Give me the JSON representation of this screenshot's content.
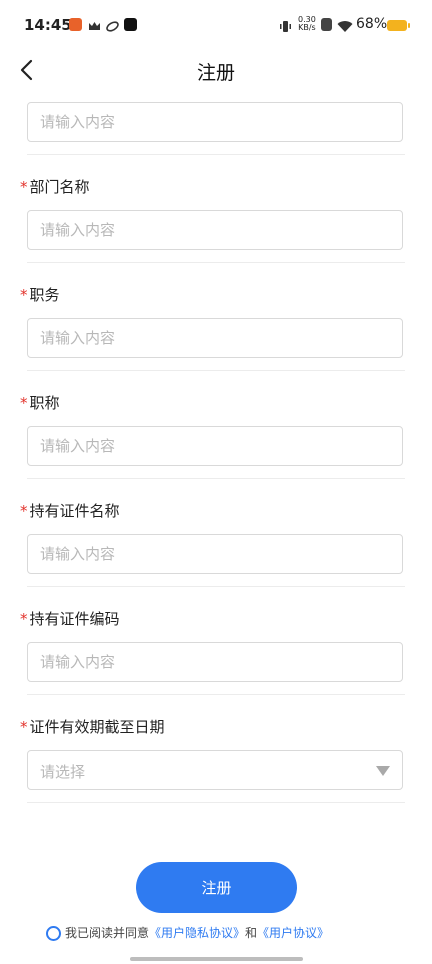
{
  "status": {
    "time": "14:45",
    "speed_top": "0.30",
    "speed_bottom": "KB/s",
    "battery": "68%"
  },
  "header": {
    "title": "注册"
  },
  "form": {
    "first_placeholder": "请输入内容",
    "fields": [
      {
        "label": "部门名称",
        "placeholder": "请输入内容"
      },
      {
        "label": "职务",
        "placeholder": "请输入内容"
      },
      {
        "label": "职称",
        "placeholder": "请输入内容"
      },
      {
        "label": "持有证件名称",
        "placeholder": "请输入内容"
      },
      {
        "label": "持有证件编码",
        "placeholder": "请输入内容"
      }
    ],
    "date_field": {
      "label": "证件有效期截至日期",
      "placeholder": "请选择"
    },
    "required_mark": "*"
  },
  "submit": {
    "label": "注册"
  },
  "agreement": {
    "prefix": "我已阅读并同意",
    "privacy": "《用户隐私协议》",
    "and": "和",
    "user": "《用户协议》"
  }
}
